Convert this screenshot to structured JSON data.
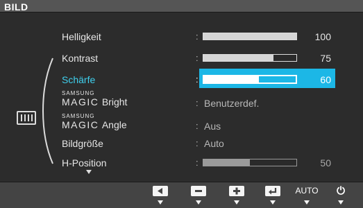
{
  "title": "BILD",
  "menu": [
    {
      "label": "Helligkeit",
      "type": "slider",
      "value": 100
    },
    {
      "label": "Kontrast",
      "type": "slider",
      "value": 75
    },
    {
      "label": "Schärfe",
      "type": "slider",
      "value": 60,
      "selected": true
    },
    {
      "label_small": "SAMSUNG",
      "label_magic": "MAGIC",
      "label_rest": "Bright",
      "type": "text",
      "value": "Benutzerdef."
    },
    {
      "label_small": "SAMSUNG",
      "label_magic": "MAGIC",
      "label_rest": "Angle",
      "type": "text",
      "value": "Aus"
    },
    {
      "label": "Bildgröße",
      "type": "text",
      "value": "Auto"
    },
    {
      "label": "H-Position",
      "type": "slider",
      "value": 50
    }
  ],
  "colon": ":",
  "buttons": {
    "left_icon": "left-arrow-icon",
    "minus_icon": "minus-icon",
    "plus_icon": "plus-icon",
    "enter_icon": "enter-icon",
    "auto_label": "AUTO",
    "power_icon": "power-icon",
    "power_glyph": "⏻"
  },
  "colors": {
    "highlight": "#1cb7e6",
    "selected_label": "#3fd0ee",
    "panel": "#2c2c2c",
    "bar_bg": "#444444"
  }
}
